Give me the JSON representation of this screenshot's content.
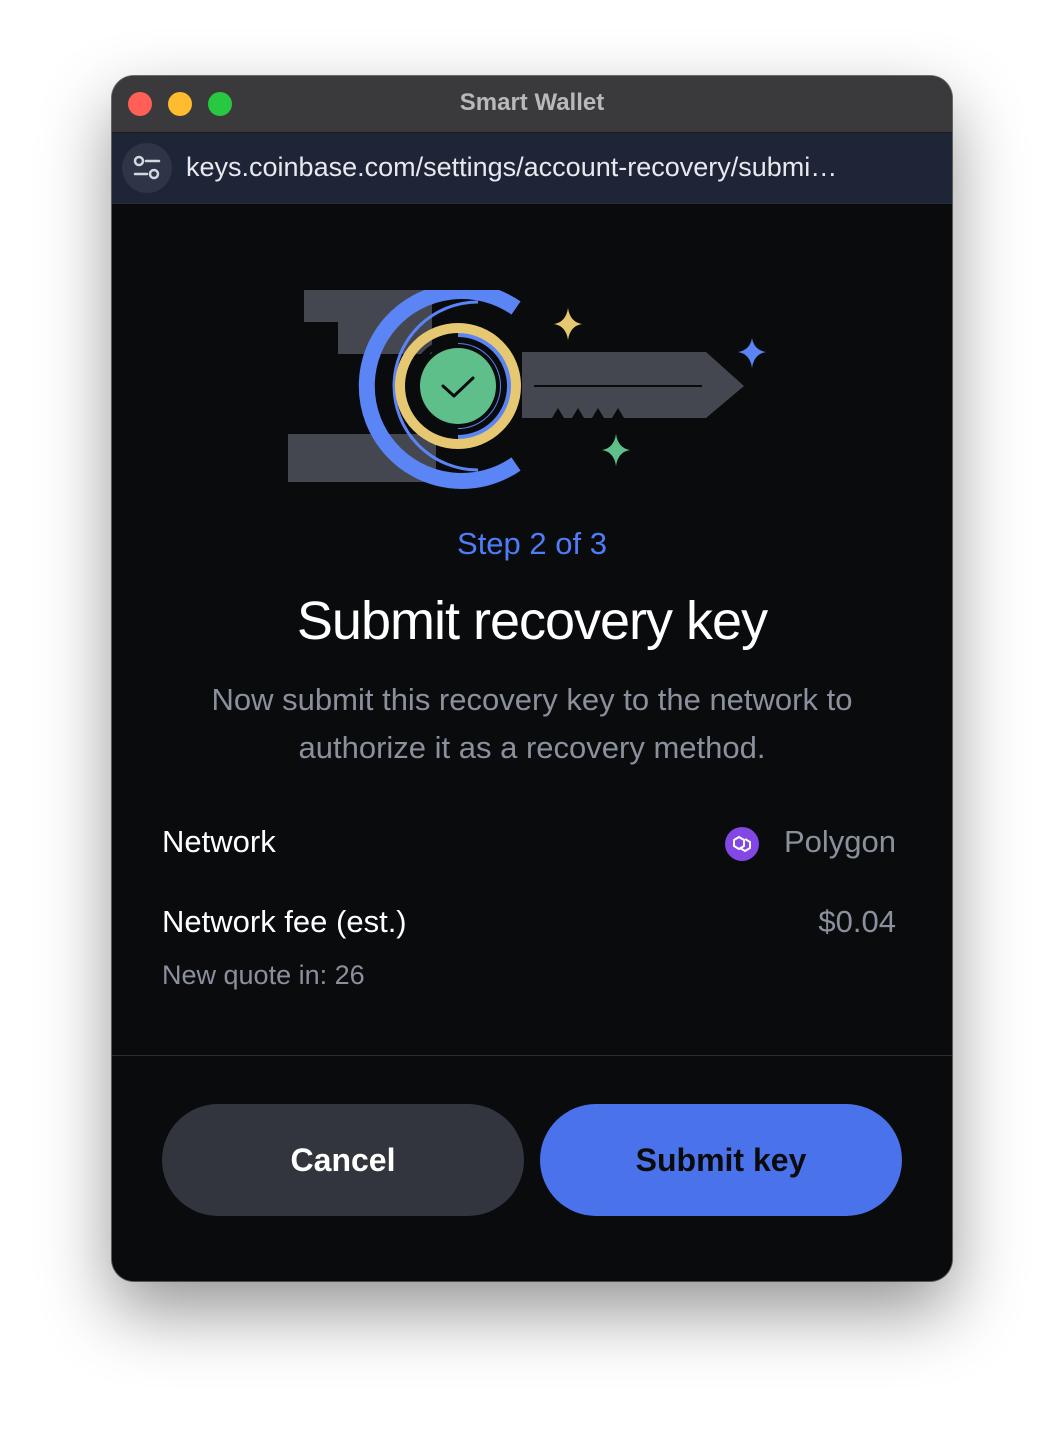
{
  "window": {
    "title": "Smart Wallet"
  },
  "browser": {
    "url": "keys.coinbase.com/settings/account-recovery/submi…",
    "site_settings_icon": "sliders-icon"
  },
  "page": {
    "step": "Step 2 of 3",
    "heading": "Submit recovery key",
    "description": "Now submit this recovery key to the network to authorize it as a recovery method.",
    "network_label": "Network",
    "network_value": "Polygon",
    "network_icon": "polygon-icon",
    "fee_label": "Network fee (est.)",
    "fee_value": "$0.04",
    "quote_text": "New quote in: 26"
  },
  "buttons": {
    "cancel": "Cancel",
    "submit": "Submit key"
  },
  "colors": {
    "accent": "#4a72ea",
    "step_text": "#4f7cf7",
    "background": "#0a0b0d",
    "check_green": "#5fbf8a",
    "ring_yellow": "#e6c873",
    "ring_blue": "#5b84f4",
    "polygon_purple": "#8247e5"
  }
}
